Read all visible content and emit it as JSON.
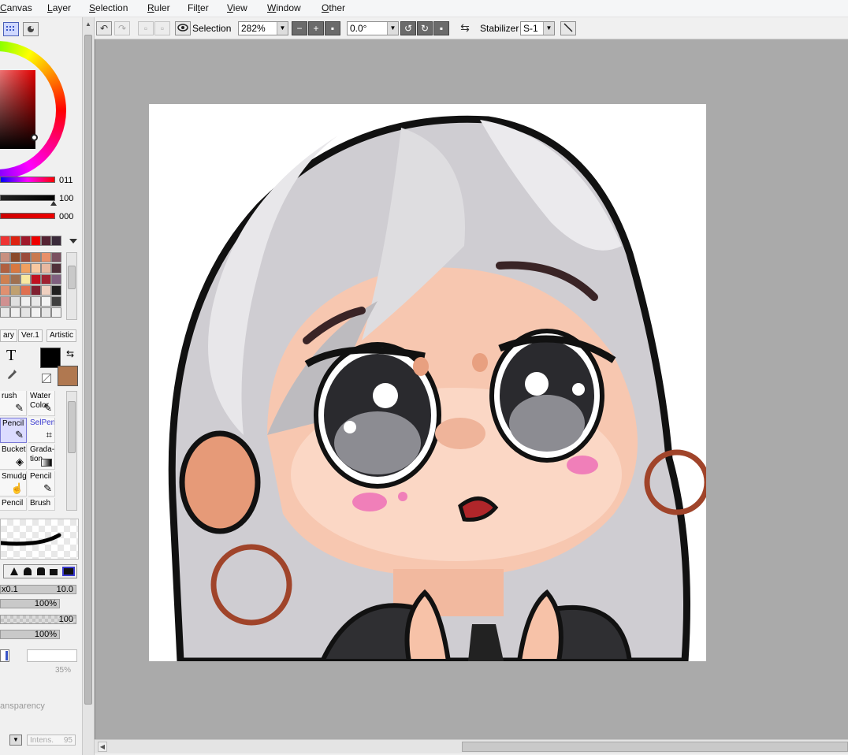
{
  "menubar": {
    "items": [
      {
        "label": "Canvas",
        "accel": "C"
      },
      {
        "label": "Layer",
        "accel": "L"
      },
      {
        "label": "Selection",
        "accel": "S"
      },
      {
        "label": "Ruler",
        "accel": "R"
      },
      {
        "label": "Filter",
        "accel": "t"
      },
      {
        "label": "View",
        "accel": "V"
      },
      {
        "label": "Window",
        "accel": "W"
      },
      {
        "label": "Other",
        "accel": "O"
      }
    ]
  },
  "toolbar": {
    "selection_label": "Selection",
    "zoom_value": "282%",
    "rotation_value": "0.0°",
    "stabilizer_label": "Stabilizer",
    "stabilizer_value": "S-1"
  },
  "color_panel": {
    "hue_value": "011",
    "sat_value": "100",
    "val_value": "000",
    "primary_color": "#000000",
    "secondary_color": "#b07850"
  },
  "tabs": [
    "ary",
    "Ver.1",
    "Artistic"
  ],
  "tools": [
    {
      "label": "rush",
      "icon": "brush-icon"
    },
    {
      "label": "Water Color",
      "icon": "water-color-icon"
    },
    {
      "label": "Pencil",
      "icon": "pencil-icon"
    },
    {
      "label": "SelPen",
      "icon": "selpen-icon"
    },
    {
      "label": "Bucket",
      "icon": "bucket-icon"
    },
    {
      "label": "Grada-tion",
      "icon": "gradation-icon"
    },
    {
      "label": "Smudge",
      "icon": "smudge-icon"
    },
    {
      "label": "Pencil",
      "icon": "pencil-icon"
    },
    {
      "label": "Pencil",
      "icon": "pencil-icon"
    },
    {
      "label": "Brush",
      "icon": "brush-icon"
    }
  ],
  "brush_params": {
    "size_prefix": "x0.1",
    "size_value": "10.0",
    "opacity_value": "100%",
    "density_value": "100",
    "blend_value": "100%",
    "percent_hint": "35%",
    "transparency_label": "ansparency",
    "intens_label": "Intens.",
    "intens_value": "95"
  },
  "accent_colors": {
    "canvas_bg": "#aaaaaa",
    "selection_blue": "#7a7ad8"
  }
}
